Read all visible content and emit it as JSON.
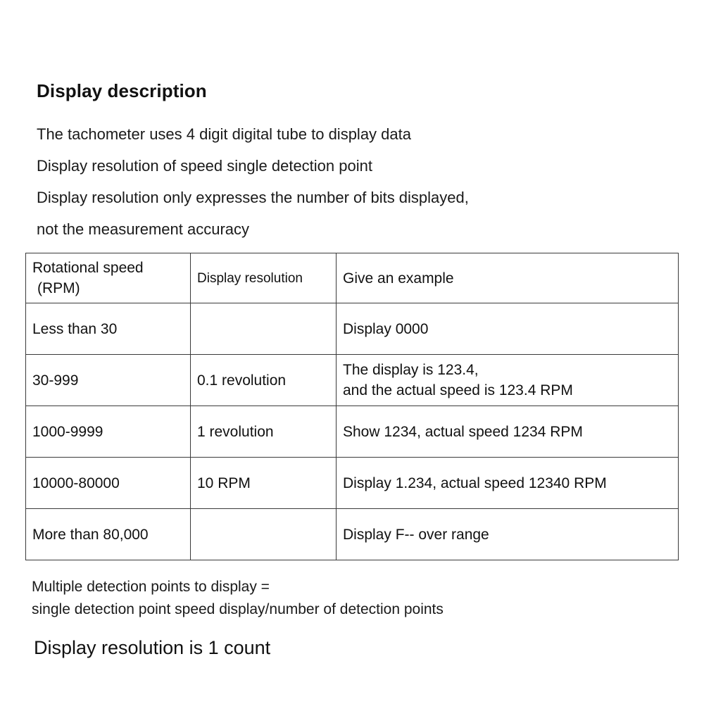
{
  "document": {
    "title": "Display description",
    "intro_lines": [
      "The tachometer uses 4 digit digital tube to display data",
      "Display resolution of speed single detection point",
      "Display resolution only expresses the number of bits displayed,",
      "not the measurement accuracy"
    ],
    "table": {
      "headers": {
        "speed_line1": "Rotational speed",
        "speed_line2": "(RPM)",
        "resolution": "Display resolution",
        "example": "Give an example"
      },
      "rows": [
        {
          "speed": "Less than 30",
          "resolution": "",
          "example_line1": "Display 0000",
          "example_line2": ""
        },
        {
          "speed": "30-999",
          "resolution": "0.1 revolution",
          "example_line1": "The display is 123.4,",
          "example_line2": "and the actual speed is 123.4 RPM"
        },
        {
          "speed": "1000-9999",
          "resolution": "1 revolution",
          "example_line1": "Show 1234, actual speed 1234 RPM",
          "example_line2": ""
        },
        {
          "speed": "10000-80000",
          "resolution": "10 RPM",
          "example_line1": "Display 1.234, actual speed 12340 RPM",
          "example_line2": ""
        },
        {
          "speed": "More than 80,000",
          "resolution": "",
          "example_line1": "Display F-- over range",
          "example_line2": ""
        }
      ]
    },
    "notes": [
      "Multiple detection points to display =",
      "single detection point speed display/number of detection points"
    ],
    "emphasis": "Display resolution is 1 count"
  },
  "colors": {
    "background": "#ffffff",
    "text": "#111111",
    "border": "#3a3a3a"
  }
}
